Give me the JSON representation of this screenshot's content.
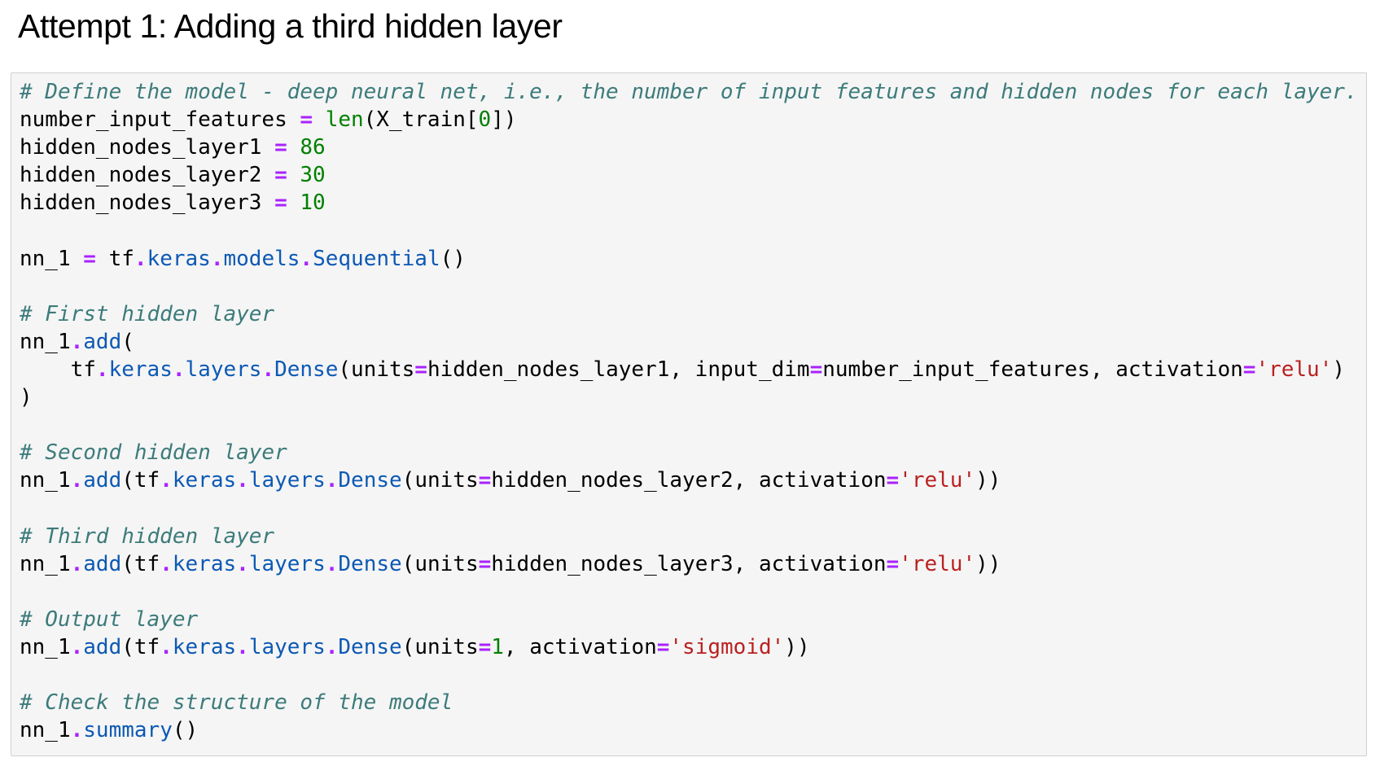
{
  "heading": "Attempt 1: Adding a third hidden layer",
  "colors": {
    "comment": "#3d7b7b",
    "operator": "#aa22ff",
    "number": "#008000",
    "builtin": "#008000",
    "attribute": "#0c59b4",
    "string": "#ba2121",
    "text": "#000000",
    "cell_background": "#f5f5f5",
    "cell_border": "#cfcfcf"
  },
  "code_lines": [
    [
      [
        "comment",
        "# Define the model - deep neural net, i.e., the number of input features and hidden nodes for each layer."
      ]
    ],
    [
      [
        "text",
        "number_input_features "
      ],
      [
        "op",
        "="
      ],
      [
        "text",
        " "
      ],
      [
        "builtin",
        "len"
      ],
      [
        "text",
        "(X_train["
      ],
      [
        "num",
        "0"
      ],
      [
        "text",
        "])"
      ]
    ],
    [
      [
        "text",
        "hidden_nodes_layer1 "
      ],
      [
        "op",
        "="
      ],
      [
        "text",
        " "
      ],
      [
        "num",
        "86"
      ]
    ],
    [
      [
        "text",
        "hidden_nodes_layer2 "
      ],
      [
        "op",
        "="
      ],
      [
        "text",
        " "
      ],
      [
        "num",
        "30"
      ]
    ],
    [
      [
        "text",
        "hidden_nodes_layer3 "
      ],
      [
        "op",
        "="
      ],
      [
        "text",
        " "
      ],
      [
        "num",
        "10"
      ]
    ],
    [],
    [
      [
        "text",
        "nn_1 "
      ],
      [
        "op",
        "="
      ],
      [
        "text",
        " tf"
      ],
      [
        "op",
        "."
      ],
      [
        "attr",
        "keras"
      ],
      [
        "op",
        "."
      ],
      [
        "attr",
        "models"
      ],
      [
        "op",
        "."
      ],
      [
        "attr",
        "Sequential"
      ],
      [
        "text",
        "()"
      ]
    ],
    [],
    [
      [
        "comment",
        "# First hidden layer"
      ]
    ],
    [
      [
        "text",
        "nn_1"
      ],
      [
        "op",
        "."
      ],
      [
        "attr",
        "add"
      ],
      [
        "text",
        "("
      ]
    ],
    [
      [
        "text",
        "    tf"
      ],
      [
        "op",
        "."
      ],
      [
        "attr",
        "keras"
      ],
      [
        "op",
        "."
      ],
      [
        "attr",
        "layers"
      ],
      [
        "op",
        "."
      ],
      [
        "attr",
        "Dense"
      ],
      [
        "text",
        "(units"
      ],
      [
        "op",
        "="
      ],
      [
        "text",
        "hidden_nodes_layer1, input_dim"
      ],
      [
        "op",
        "="
      ],
      [
        "text",
        "number_input_features, activation"
      ],
      [
        "op",
        "="
      ],
      [
        "str",
        "'relu'"
      ],
      [
        "text",
        ")"
      ]
    ],
    [
      [
        "text",
        ")"
      ]
    ],
    [],
    [
      [
        "comment",
        "# Second hidden layer"
      ]
    ],
    [
      [
        "text",
        "nn_1"
      ],
      [
        "op",
        "."
      ],
      [
        "attr",
        "add"
      ],
      [
        "text",
        "(tf"
      ],
      [
        "op",
        "."
      ],
      [
        "attr",
        "keras"
      ],
      [
        "op",
        "."
      ],
      [
        "attr",
        "layers"
      ],
      [
        "op",
        "."
      ],
      [
        "attr",
        "Dense"
      ],
      [
        "text",
        "(units"
      ],
      [
        "op",
        "="
      ],
      [
        "text",
        "hidden_nodes_layer2, activation"
      ],
      [
        "op",
        "="
      ],
      [
        "str",
        "'relu'"
      ],
      [
        "text",
        "))"
      ]
    ],
    [],
    [
      [
        "comment",
        "# Third hidden layer"
      ]
    ],
    [
      [
        "text",
        "nn_1"
      ],
      [
        "op",
        "."
      ],
      [
        "attr",
        "add"
      ],
      [
        "text",
        "(tf"
      ],
      [
        "op",
        "."
      ],
      [
        "attr",
        "keras"
      ],
      [
        "op",
        "."
      ],
      [
        "attr",
        "layers"
      ],
      [
        "op",
        "."
      ],
      [
        "attr",
        "Dense"
      ],
      [
        "text",
        "(units"
      ],
      [
        "op",
        "="
      ],
      [
        "text",
        "hidden_nodes_layer3, activation"
      ],
      [
        "op",
        "="
      ],
      [
        "str",
        "'relu'"
      ],
      [
        "text",
        "))"
      ]
    ],
    [],
    [
      [
        "comment",
        "# Output layer"
      ]
    ],
    [
      [
        "text",
        "nn_1"
      ],
      [
        "op",
        "."
      ],
      [
        "attr",
        "add"
      ],
      [
        "text",
        "(tf"
      ],
      [
        "op",
        "."
      ],
      [
        "attr",
        "keras"
      ],
      [
        "op",
        "."
      ],
      [
        "attr",
        "layers"
      ],
      [
        "op",
        "."
      ],
      [
        "attr",
        "Dense"
      ],
      [
        "text",
        "(units"
      ],
      [
        "op",
        "="
      ],
      [
        "num",
        "1"
      ],
      [
        "text",
        ", activation"
      ],
      [
        "op",
        "="
      ],
      [
        "str",
        "'sigmoid'"
      ],
      [
        "text",
        "))"
      ]
    ],
    [],
    [
      [
        "comment",
        "# Check the structure of the model"
      ]
    ],
    [
      [
        "text",
        "nn_1"
      ],
      [
        "op",
        "."
      ],
      [
        "attr",
        "summary"
      ],
      [
        "text",
        "()"
      ]
    ]
  ]
}
